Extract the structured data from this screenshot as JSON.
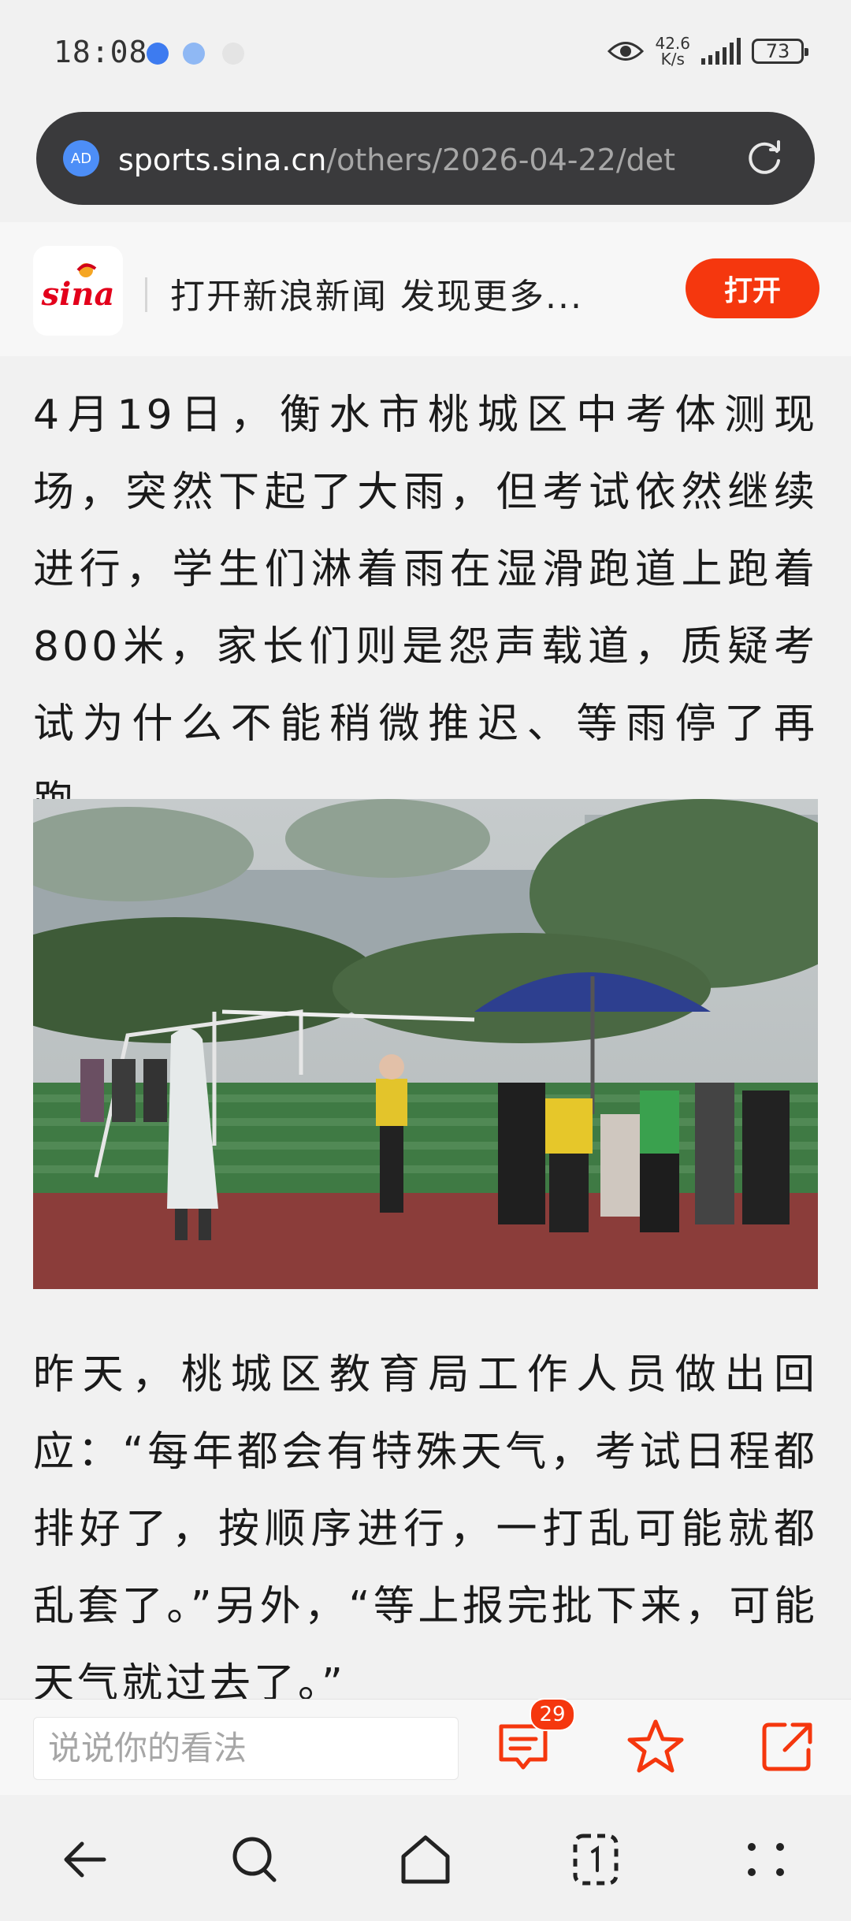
{
  "status_bar": {
    "time": "18:08",
    "net_speed_value": "42.6",
    "net_speed_unit": "K/s",
    "battery": "73",
    "notification_icons": [
      "voice-icon",
      "app-icon",
      "cloud-icon"
    ]
  },
  "url_bar": {
    "ad_label": "AD",
    "host": "sports.sina.cn",
    "path": "/others/2026-04-22/det"
  },
  "promo": {
    "logo_text": "sina",
    "text": "打开新浪新闻 发现更多...",
    "open_button": "打开"
  },
  "article": {
    "paragraph_1": "4月19日，衡水市桃城区中考体测现场，突然下起了大雨，但考试依然继续进行，学生们淋着雨在湿滑跑道上跑着800米，家长们则是怨声载道，质疑考试为什么不能稍微推迟、等雨停了再跑。",
    "paragraph_2": "昨天，桃城区教育局工作人员做出回应：“每年都会有特殊天气，考试日程都排好了，按顺序进行，一打乱可能就都乱套了。”另外，“等上报完批下来，可能天气就过去了。”"
  },
  "comment_bar": {
    "placeholder": "说说你的看法",
    "comment_count": "29"
  },
  "colors": {
    "accent": "#f5370e",
    "url_bar_bg": "#3a3a3c",
    "page_bg": "#f1f1f1"
  }
}
